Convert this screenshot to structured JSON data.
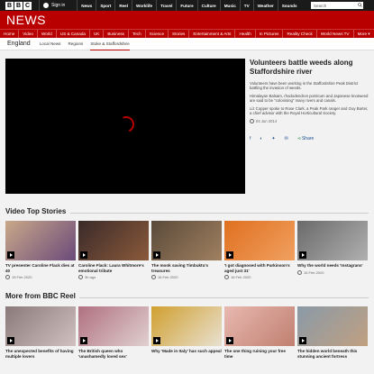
{
  "topbar": {
    "logo_letters": [
      "B",
      "B",
      "C"
    ],
    "signin": "Sign in",
    "nav": [
      "News",
      "Sport",
      "Reel",
      "Worklife",
      "Travel",
      "Future",
      "Culture",
      "Music",
      "TV",
      "Weather",
      "Sounds"
    ],
    "search_placeholder": "Search"
  },
  "header": {
    "title": "NEWS"
  },
  "mainnav": [
    "Home",
    "Video",
    "World",
    "US & Canada",
    "UK",
    "Business",
    "Tech",
    "Science",
    "Stories",
    "Entertainment & Arts",
    "Health",
    "In Pictures",
    "Reality Check",
    "World News TV",
    "More ▾"
  ],
  "subnav": {
    "region": "England",
    "links": [
      "Local News",
      "Regions",
      "Stoke & Staffordshire"
    ]
  },
  "article": {
    "headline": "Volunteers battle weeds along Staffordshire river",
    "paragraphs": [
      "Volunteers have been working in the Staffordshire Peak District battling the invasion of weeds.",
      "Himalayan Balsam, rhododendron ponticum and Japanese knotweed are said to be \"colonising\" many rivers and canals.",
      "Liz Copper spoke to Rose Clark, a Peak Park ranger and Guy Barter, a chief advisor with the Royal Horticultural Society."
    ],
    "date": "04 Jun 2014",
    "share_label": "Share"
  },
  "video_top_stories": {
    "heading": "Video Top Stories",
    "items": [
      {
        "title": "TV presenter Caroline Flack dies at 40",
        "meta": "15 Feb 2020",
        "colors": [
          "#c9a88a",
          "#6b4a7a"
        ]
      },
      {
        "title": "Caroline Flack: Laura Whitmore's emotional tribute",
        "meta": "3h ago",
        "colors": [
          "#3a2a2a",
          "#8b5a3a"
        ]
      },
      {
        "title": "The monk saving Timbuktu's treasures",
        "meta": "16 Feb 2020",
        "colors": [
          "#5a4a3a",
          "#a08060"
        ]
      },
      {
        "title": "'I got diagnosed with Parkinson's aged just 31'",
        "meta": "16 Feb 2020",
        "colors": [
          "#e07020",
          "#f0a060"
        ]
      },
      {
        "title": "Why the world needs 'Instagrans'",
        "meta": "16 Feb 2020",
        "colors": [
          "#6a6a6a",
          "#b0b0b0"
        ]
      }
    ]
  },
  "more_reel": {
    "heading": "More from BBC Reel",
    "items": [
      {
        "title": "The unexpected benefits of having multiple lovers",
        "colors": [
          "#8a7a7a",
          "#d0c0c0"
        ]
      },
      {
        "title": "The British queen who 'unashamedly loved sex'",
        "colors": [
          "#b07080",
          "#e0d0d0"
        ]
      },
      {
        "title": "Why 'Made in Italy' has such appeal",
        "colors": [
          "#d0a030",
          "#e8e0d0"
        ]
      },
      {
        "title": "The one thing ruining your free time",
        "colors": [
          "#e8b8b0",
          "#c08070"
        ]
      },
      {
        "title": "The hidden world beneath this stunning ancient fortress",
        "colors": [
          "#8a9aa8",
          "#c0a080"
        ]
      }
    ]
  },
  "colors": {
    "brand_red": "#b80000",
    "topbar": "#1a1a1a"
  }
}
